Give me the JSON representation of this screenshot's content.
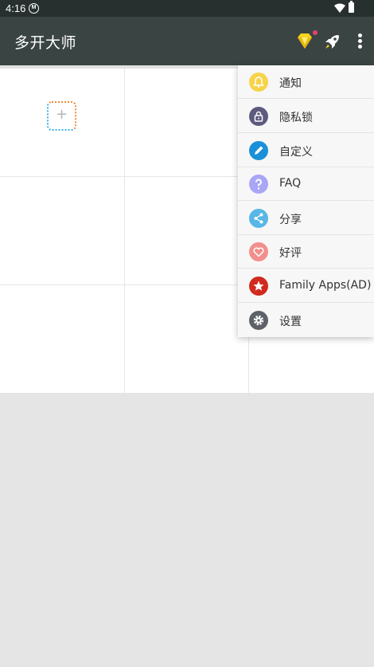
{
  "status_bar": {
    "time": "4:16",
    "notification_glyph": "M"
  },
  "app_bar": {
    "title": "多开大师",
    "icons": [
      "diamond-icon",
      "rocket-icon",
      "more-vert-icon"
    ]
  },
  "grid": {
    "add_glyph": "+"
  },
  "menu": {
    "items": [
      {
        "label": "通知",
        "icon": "bell-icon",
        "color": "#f7d34a"
      },
      {
        "label": "隐私锁",
        "icon": "lock-icon",
        "color": "#5c5b7e"
      },
      {
        "label": "自定义",
        "icon": "pencil-icon",
        "color": "#1a90d8"
      },
      {
        "label": "FAQ",
        "icon": "question-icon",
        "color": "#a8a6f5"
      },
      {
        "label": "分享",
        "icon": "share-icon",
        "color": "#58b7e6"
      },
      {
        "label": "好评",
        "icon": "heart-icon",
        "color": "#f28f8c"
      },
      {
        "label": "Family Apps(AD)",
        "icon": "star-icon",
        "color": "#d22a1e"
      },
      {
        "label": "设置",
        "icon": "gear-icon",
        "color": "#5d6268"
      }
    ]
  },
  "colors": {
    "status_bar": "#28302f",
    "app_bar": "#3a4443",
    "background": "#e5e5e5"
  }
}
